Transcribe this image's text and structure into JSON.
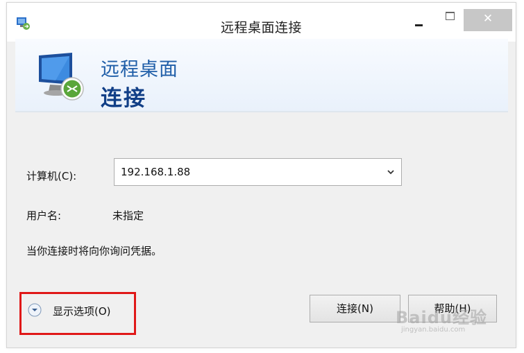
{
  "window": {
    "title": "远程桌面连接",
    "close_symbol": "✕"
  },
  "banner": {
    "line1": "远程桌面",
    "line2": "连接",
    "icon": "remote-desktop-monitor-icon"
  },
  "form": {
    "computer_label": "计算机(C):",
    "computer_value": "192.168.1.88",
    "username_label": "用户名:",
    "username_value": "未指定",
    "credentials_note": "当你连接时将向你询问凭据。"
  },
  "options": {
    "label": "显示选项(O)",
    "icon": "chevron-down-circle-icon"
  },
  "buttons": {
    "connect": "连接(N)",
    "help": "帮助(H)"
  },
  "watermark": {
    "text": "Baidu经验",
    "sub": "jingyan.baidu.com"
  },
  "colors": {
    "highlight_box": "#e01818",
    "banner_title": "#1f5ea8",
    "banner_subtitle": "#113f87"
  }
}
